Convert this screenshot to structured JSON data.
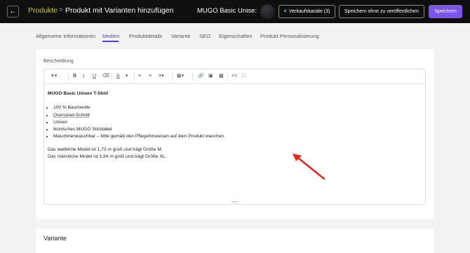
{
  "header": {
    "back_icon": "arrow-left-icon",
    "breadcrumb_root": "Produkte",
    "breadcrumb_separator": ">",
    "breadcrumb_current": "Produkt mit Varianten hinzufügen",
    "product_name": "MUGO Basic Unise:",
    "sales_channels_label": "Verkaufskanäle (3)",
    "save_draft_label": "Speichern ohne zu veröffentlichen",
    "save_label": "Speichern",
    "accent_color": "#7a55e8",
    "status_color": "#3ad06b"
  },
  "tabs": [
    {
      "label": "Allgemeine Informationen"
    },
    {
      "label": "Medien",
      "active": true
    },
    {
      "label": "Produktdetails"
    },
    {
      "label": "Variante"
    },
    {
      "label": "SEO"
    },
    {
      "label": "Eigenschaften"
    },
    {
      "label": "Produkt Personalisierung"
    }
  ],
  "description": {
    "label": "Beschreibung",
    "toolbar_icons": [
      "magic-wand-icon",
      "bold-icon",
      "italic-icon",
      "underline-icon",
      "eraser-icon",
      "text-color-icon",
      "bullet-list-icon",
      "numbered-list-icon",
      "align-icon",
      "table-icon",
      "link-icon",
      "image-icon",
      "video-icon",
      "code-icon",
      "fullscreen-icon"
    ],
    "title": "MUGO Basic Unisex T-Shirt",
    "bullets": [
      "100 % Baumwolle",
      "Oversized-Schnitt",
      "Unisex",
      "Ikonisches MUGO Sticklabel",
      "Maschinenwaschbar – bitte gemäß den Pflegehinweisen auf dem Produkt waschen."
    ],
    "paragraph_1": "Das weibliche Model ist 1,73 m groß und trägt Größe M.",
    "paragraph_2": "Das männliche Model ist 1,84 m groß und trägt Größe XL."
  },
  "variant_section": {
    "title": "Variante"
  },
  "annotation": {
    "arrow_color": "#e0281e"
  }
}
